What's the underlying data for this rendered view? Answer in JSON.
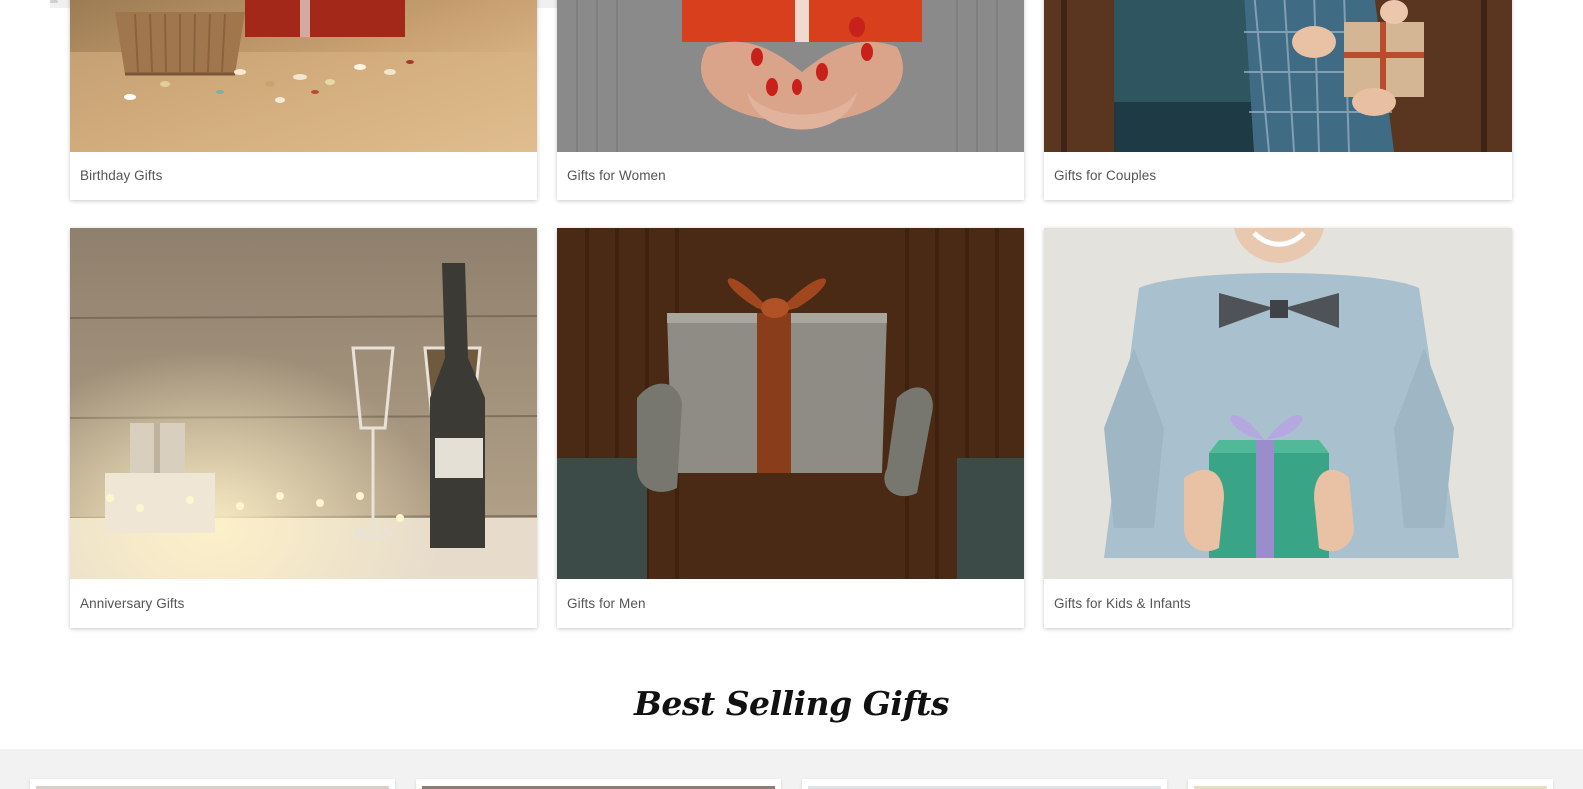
{
  "categories": [
    {
      "label": "Birthday Gifts"
    },
    {
      "label": "Gifts for Women"
    },
    {
      "label": "Gifts for Couples"
    },
    {
      "label": "Anniversary Gifts"
    },
    {
      "label": "Gifts for Men"
    },
    {
      "label": "Gifts for Kids & Infants"
    }
  ],
  "best_selling": {
    "title": "Best Selling Gifts"
  },
  "colors": {
    "label_text": "#555555",
    "band_background": "#f2f2f2",
    "title_text": "#111111"
  }
}
